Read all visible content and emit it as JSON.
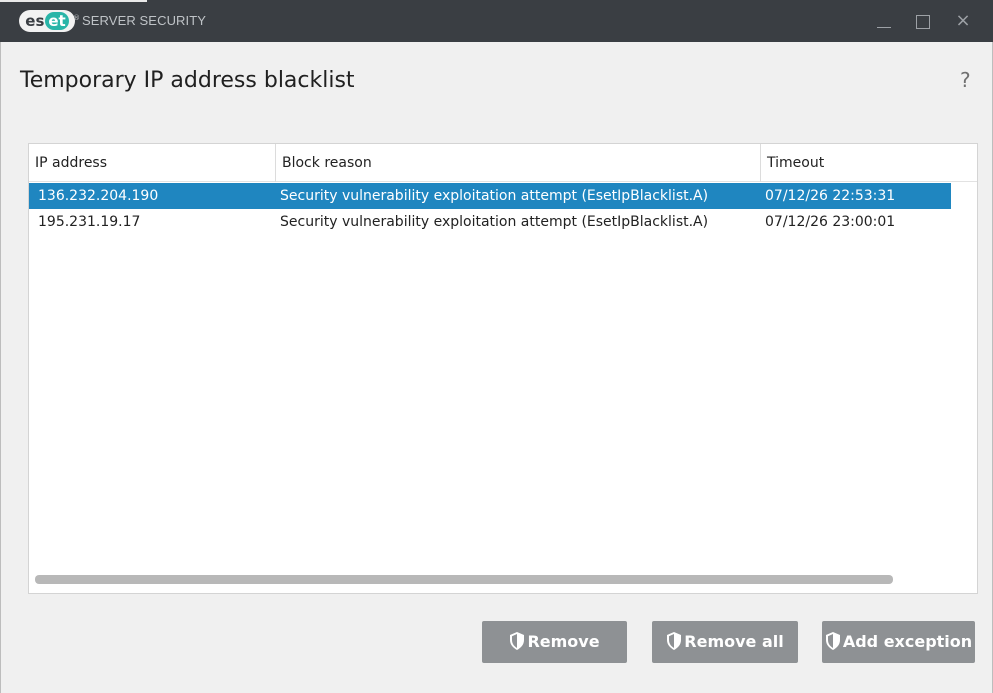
{
  "window": {
    "logo_text": "eset",
    "app_title": "SERVER SECURITY"
  },
  "page": {
    "title": "Temporary IP address blacklist",
    "help": "?"
  },
  "table": {
    "columns": [
      "IP address",
      "Block reason",
      "Timeout"
    ],
    "rows": [
      {
        "ip": "136.232.204.190",
        "reason": "Security vulnerability exploitation attempt (EsetIpBlacklist.A)",
        "timeout": "07/12/26 22:53:31",
        "selected": true
      },
      {
        "ip": "195.231.19.17",
        "reason": "Security vulnerability exploitation attempt (EsetIpBlacklist.A)",
        "timeout": "07/12/26 23:00:01",
        "selected": false
      }
    ]
  },
  "buttons": {
    "remove": "Remove",
    "remove_all": "Remove all",
    "add_exception": "Add exception"
  },
  "colors": {
    "titlebar": "#3a3e43",
    "selection": "#1f86c0",
    "button": "#8e9194",
    "brand_teal": "#29b5a8"
  },
  "icons": {
    "button_icon": "shield-icon",
    "close": "close-icon",
    "minimize": "minimize-icon",
    "maximize": "maximize-icon"
  }
}
